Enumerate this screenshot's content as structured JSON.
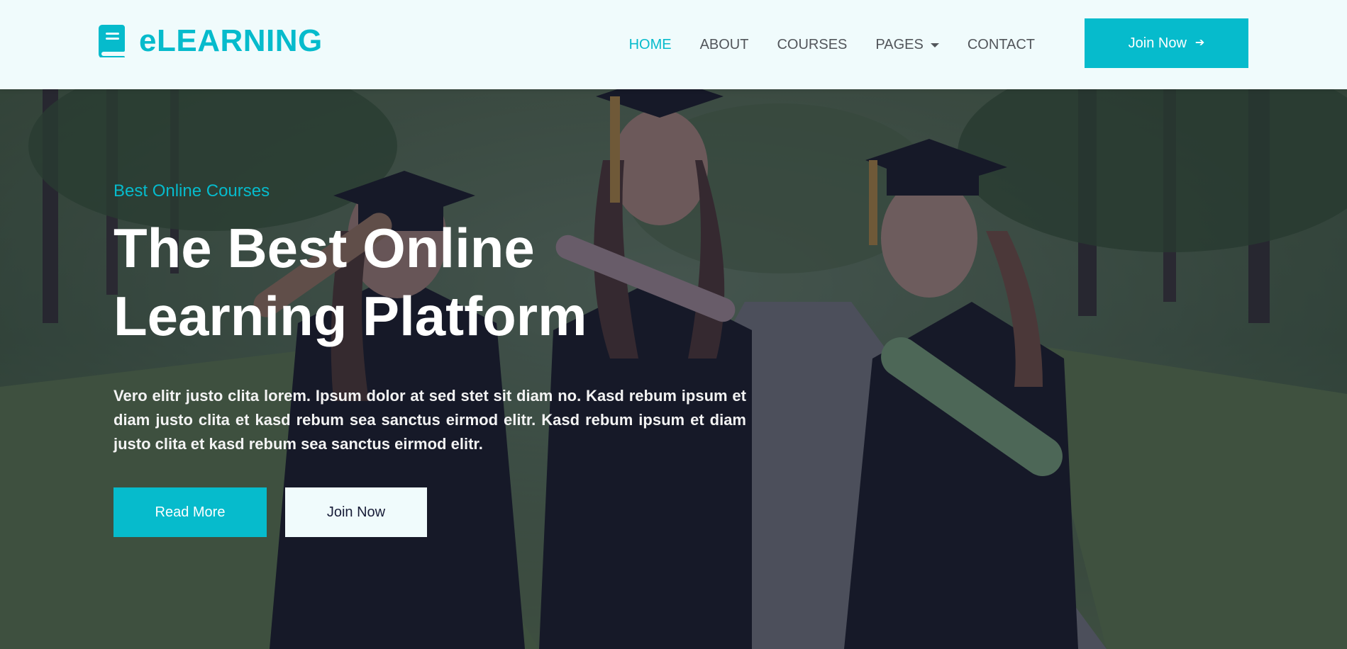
{
  "brand": {
    "name": "eLEARNING",
    "icon": "book-icon",
    "color": "#06BBCC"
  },
  "nav": {
    "items": [
      {
        "label": "HOME",
        "active": true
      },
      {
        "label": "ABOUT",
        "active": false
      },
      {
        "label": "COURSES",
        "active": false
      },
      {
        "label": "PAGES",
        "active": false,
        "has_dropdown": true
      },
      {
        "label": "CONTACT",
        "active": false
      }
    ],
    "join_button": {
      "label": "Join Now",
      "icon": "arrow-right-icon"
    }
  },
  "hero": {
    "eyebrow": "Best Online Courses",
    "title": "The Best Online Learning Platform",
    "description": "Vero elitr justo clita lorem. Ipsum dolor at sed stet sit diam no. Kasd rebum ipsum et diam justo clita et kasd rebum sea sanctus eirmod elitr. Kasd rebum ipsum et diam justo clita et kasd rebum sea sanctus eirmod elitr.",
    "read_more": "Read More",
    "join_now": "Join Now",
    "background_image": "graduates-photo"
  },
  "colors": {
    "primary": "#06BBCC",
    "light": "#F0FBFC",
    "dark": "#181D38",
    "nav_text": "#52565B"
  }
}
